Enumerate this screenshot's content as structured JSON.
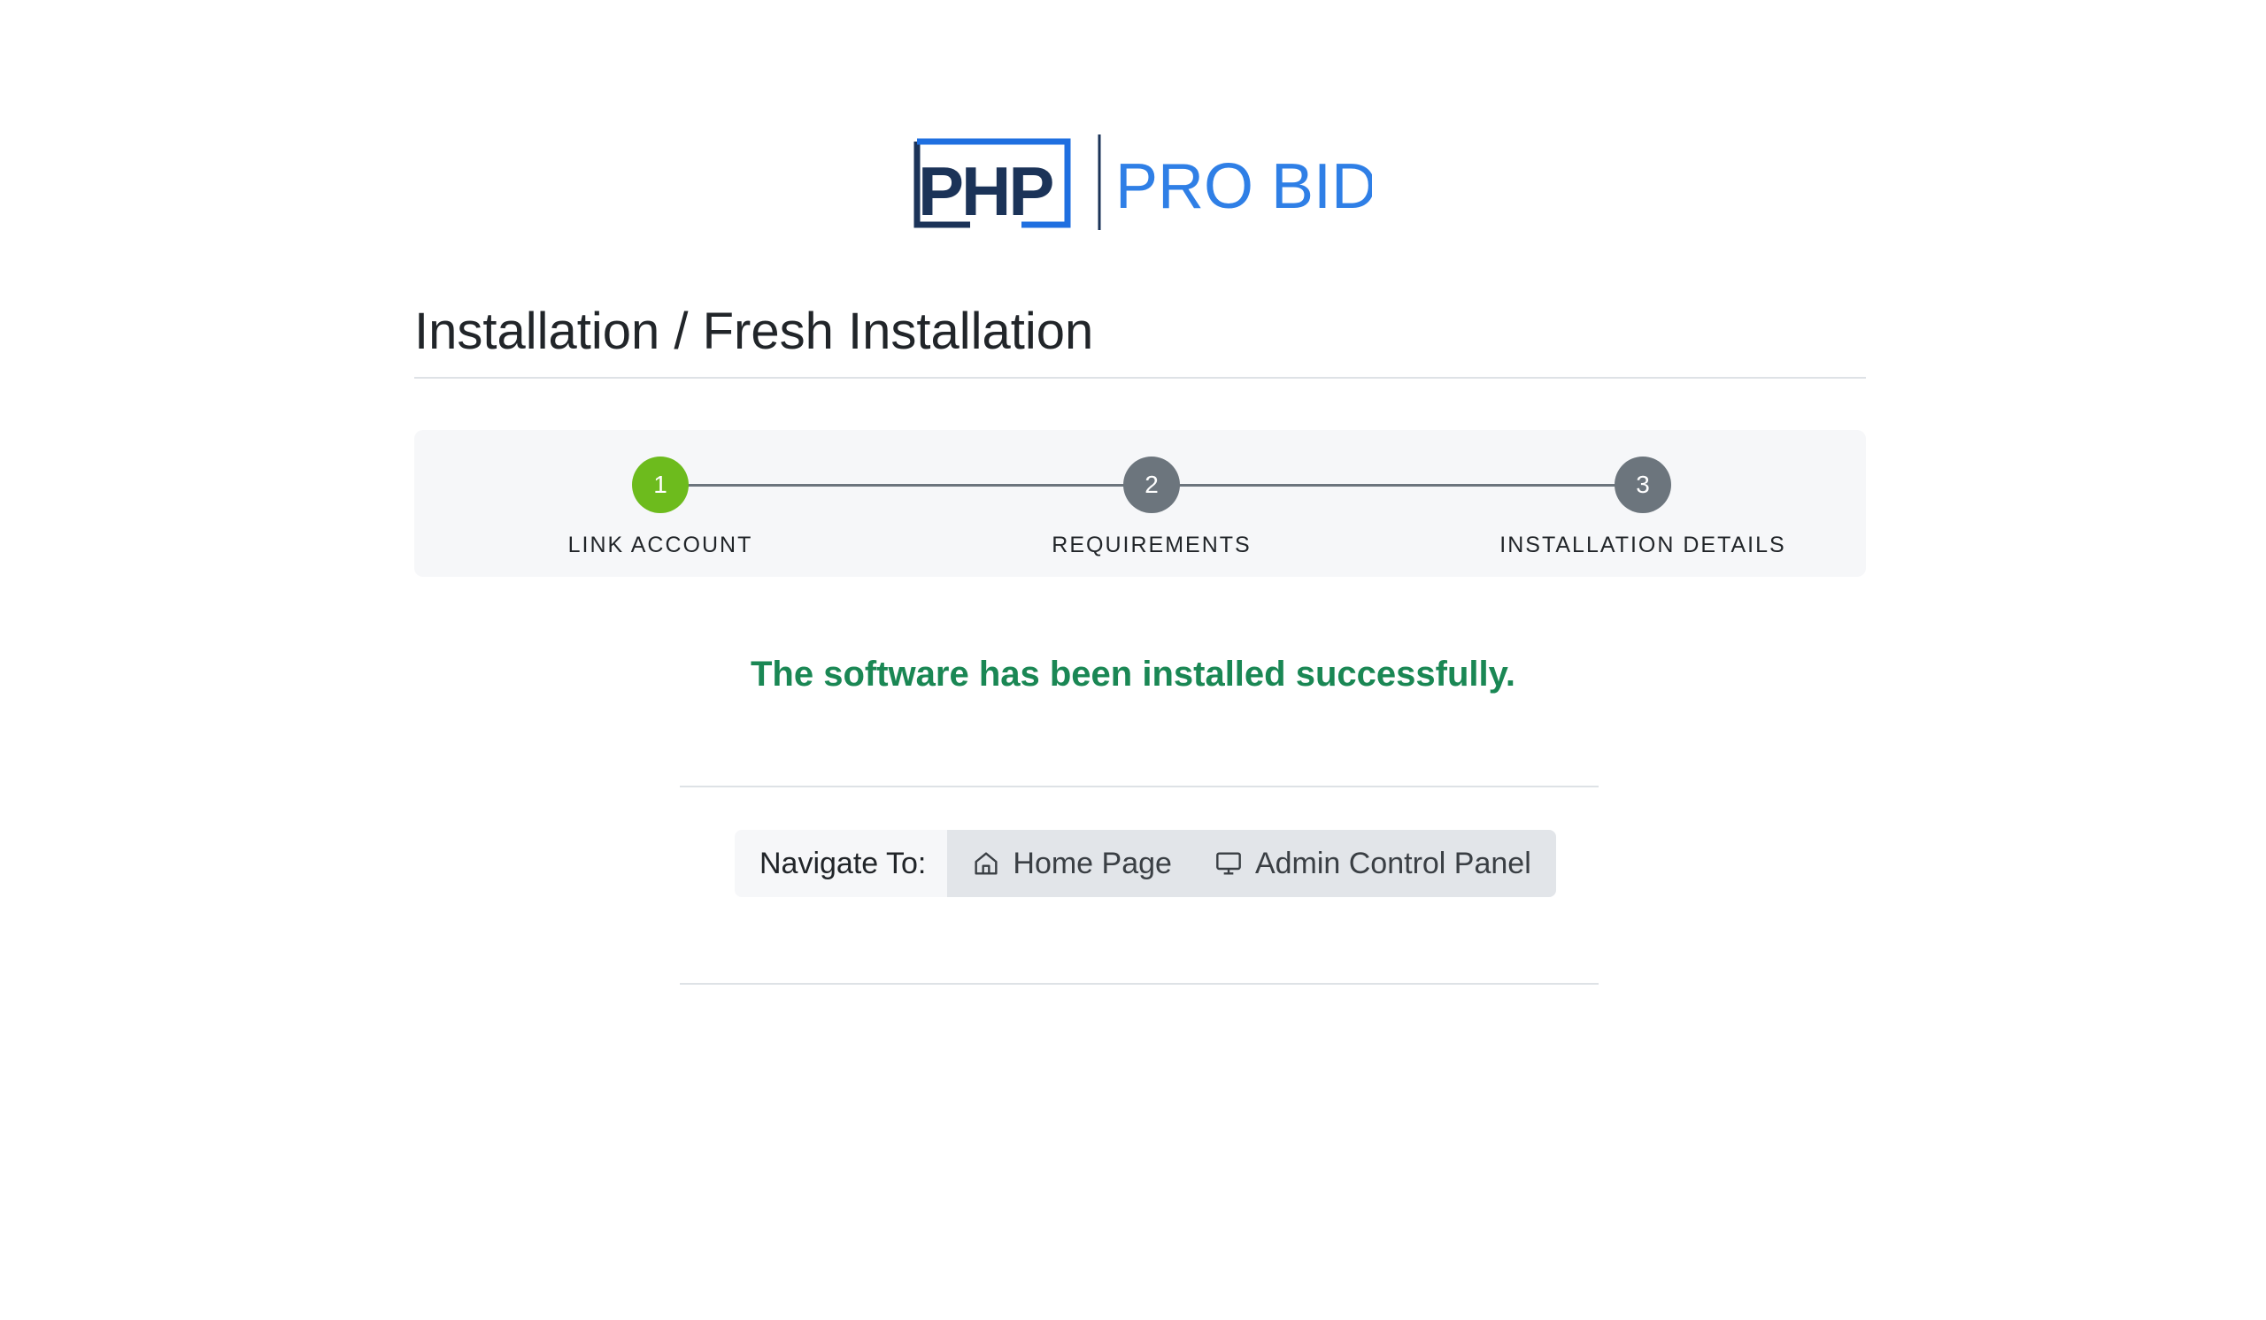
{
  "logo": {
    "php": "PHP",
    "pro_bid": "PRO BID",
    "colors": {
      "php_dark": "#1b3358",
      "php_blue": "#1f6fe0",
      "pro_bid": "#2f7fe6",
      "divider": "#1b3358"
    }
  },
  "page": {
    "title": "Installation / Fresh Installation"
  },
  "stepper": {
    "steps": [
      {
        "number": "1",
        "label": "LINK ACCOUNT",
        "status": "done"
      },
      {
        "number": "2",
        "label": "REQUIREMENTS",
        "status": "pending"
      },
      {
        "number": "3",
        "label": "INSTALLATION DETAILS",
        "status": "pending"
      }
    ],
    "colors": {
      "done": "#6dbb1d",
      "pending": "#6c757d"
    }
  },
  "result": {
    "message": "The software has been installed successfully.",
    "color": "#1a8754"
  },
  "navigate": {
    "label": "Navigate To:",
    "home": {
      "label": "Home Page",
      "icon": "home-icon"
    },
    "admin": {
      "label": "Admin Control Panel",
      "icon": "monitor-icon"
    }
  }
}
